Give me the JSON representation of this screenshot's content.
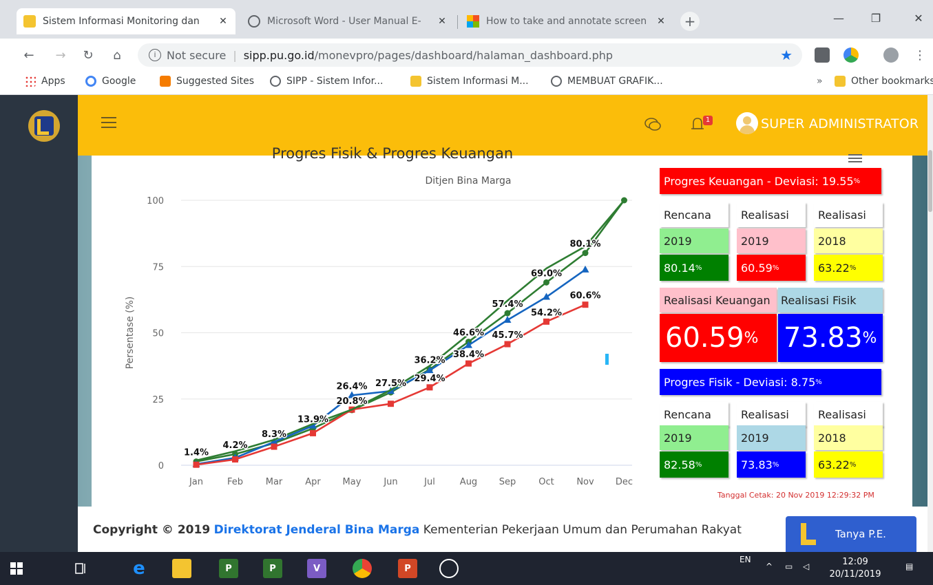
{
  "browser": {
    "tabs": [
      {
        "title": "Sistem Informasi Monitoring dan",
        "active": true
      },
      {
        "title": "Microsoft Word - User Manual E-",
        "active": false
      },
      {
        "title": "How to take and annotate screen",
        "active": false
      }
    ],
    "url_security": "Not secure",
    "url_host": "sipp.pu.go.id",
    "url_path": "/monevpro/pages/dashboard/halaman_dashboard.php",
    "bookmarks": [
      "Apps",
      "Google",
      "Suggested Sites",
      "SIPP - Sistem Infor...",
      "Sistem Informasi M...",
      "MEMBUAT GRAFIK..."
    ],
    "bookmarks_overflow": "»",
    "other_bookmarks": "Other bookmarks"
  },
  "header": {
    "user": "SUPER ADMINISTRATOR",
    "notification_count": "1"
  },
  "chart_data": {
    "type": "line",
    "title": "Progres Fisik & Progres Keuangan",
    "subtitle": "Ditjen Bina Marga",
    "ylabel": "Persentase (%)",
    "categories": [
      "Jan",
      "Feb",
      "Mar",
      "Apr",
      "May",
      "Jun",
      "Jul",
      "Aug",
      "Sep",
      "Oct",
      "Nov",
      "Dec"
    ],
    "ylim": [
      0,
      100
    ],
    "yticks": [
      0,
      25,
      50,
      75,
      100
    ],
    "series": [
      {
        "color": "#2e7d32",
        "marker": "circle",
        "values": [
          1.4,
          4.2,
          8.3,
          13.9,
          20.8,
          27.5,
          36.2,
          46.6,
          57.4,
          69.0,
          80.1,
          100
        ]
      },
      {
        "color": "#1565c0",
        "marker": "triangle",
        "values": [
          0.4,
          2.8,
          8.8,
          14.9,
          26.4,
          28.0,
          35.8,
          45.3,
          54.8,
          63.5,
          73.8,
          null
        ]
      },
      {
        "color": "#e53935",
        "marker": "square",
        "values": [
          0.2,
          2.2,
          7.0,
          12.1,
          21.0,
          23.2,
          29.4,
          38.4,
          45.7,
          54.2,
          60.6,
          null
        ]
      },
      {
        "color": "#2e7d32",
        "marker": "none",
        "values": [
          1.8,
          5.3,
          9.6,
          15.6,
          21.0,
          28.4,
          37.5,
          49.4,
          62.1,
          74.3,
          82.6,
          100
        ]
      }
    ],
    "data_labels": [
      {
        "text": "1.4%",
        "x": "Jan",
        "y": 1.4
      },
      {
        "text": "4.2%",
        "x": "Feb",
        "y": 4.2
      },
      {
        "text": "8.3%",
        "x": "Mar",
        "y": 8.3
      },
      {
        "text": "13.9%",
        "x": "Apr",
        "y": 13.9
      },
      {
        "text": "26.4%",
        "x": "May",
        "y": 26.4
      },
      {
        "text": "20.8%",
        "x": "May",
        "y": 20.8
      },
      {
        "text": "27.5%",
        "x": "Jun",
        "y": 27.5
      },
      {
        "text": "36.2%",
        "x": "Jul",
        "y": 36.2
      },
      {
        "text": "29.4%",
        "x": "Jul",
        "y": 29.4
      },
      {
        "text": "46.6%",
        "x": "Aug",
        "y": 46.6
      },
      {
        "text": "38.4%",
        "x": "Aug",
        "y": 38.4
      },
      {
        "text": "57.4%",
        "x": "Sep",
        "y": 57.4
      },
      {
        "text": "45.7%",
        "x": "Sep",
        "y": 45.7
      },
      {
        "text": "69.0%",
        "x": "Oct",
        "y": 69.0
      },
      {
        "text": "54.2%",
        "x": "Oct",
        "y": 54.2
      },
      {
        "text": "80.1%",
        "x": "Nov",
        "y": 80.1
      },
      {
        "text": "60.6%",
        "x": "Nov",
        "y": 60.6
      }
    ]
  },
  "keuangan": {
    "header": "Progres Keuangan - Deviasi: 19.55",
    "rencana_label": "Rencana",
    "realisasi_label": "Realisasi",
    "realisasi2_label": "Realisasi",
    "year_rencana": "2019",
    "year_realisasi": "2019",
    "year_prev": "2018",
    "val_rencana": "80.14",
    "val_realisasi": "60.59",
    "val_prev": "63.22"
  },
  "summary": {
    "keuangan_label": "Realisasi Keuangan",
    "fisik_label": "Realisasi Fisik",
    "keuangan_value": "60.59",
    "fisik_value": "73.83"
  },
  "fisik": {
    "header": "Progres Fisik - Deviasi: 8.75",
    "rencana_label": "Rencana",
    "realisasi_label": "Realisasi",
    "realisasi2_label": "Realisasi",
    "year_rencana": "2019",
    "year_realisasi": "2019",
    "year_prev": "2018",
    "val_rencana": "82.58",
    "val_realisasi": "73.83",
    "val_prev": "63.22"
  },
  "percent": "%",
  "print_date": "Tanggal Cetak: 20 Nov 2019 12:29:32 PM",
  "footer": {
    "copyright_prefix": "Copyright © 2019",
    "org": "Direktorat Jenderal Bina Marga",
    "ministry": "Kementerian Pekerjaan Umum dan Perumahan Rakyat",
    "help_button": "Tanya P.E."
  },
  "taskbar": {
    "lang": "EN",
    "time": "12:09",
    "date": "20/11/2019"
  }
}
